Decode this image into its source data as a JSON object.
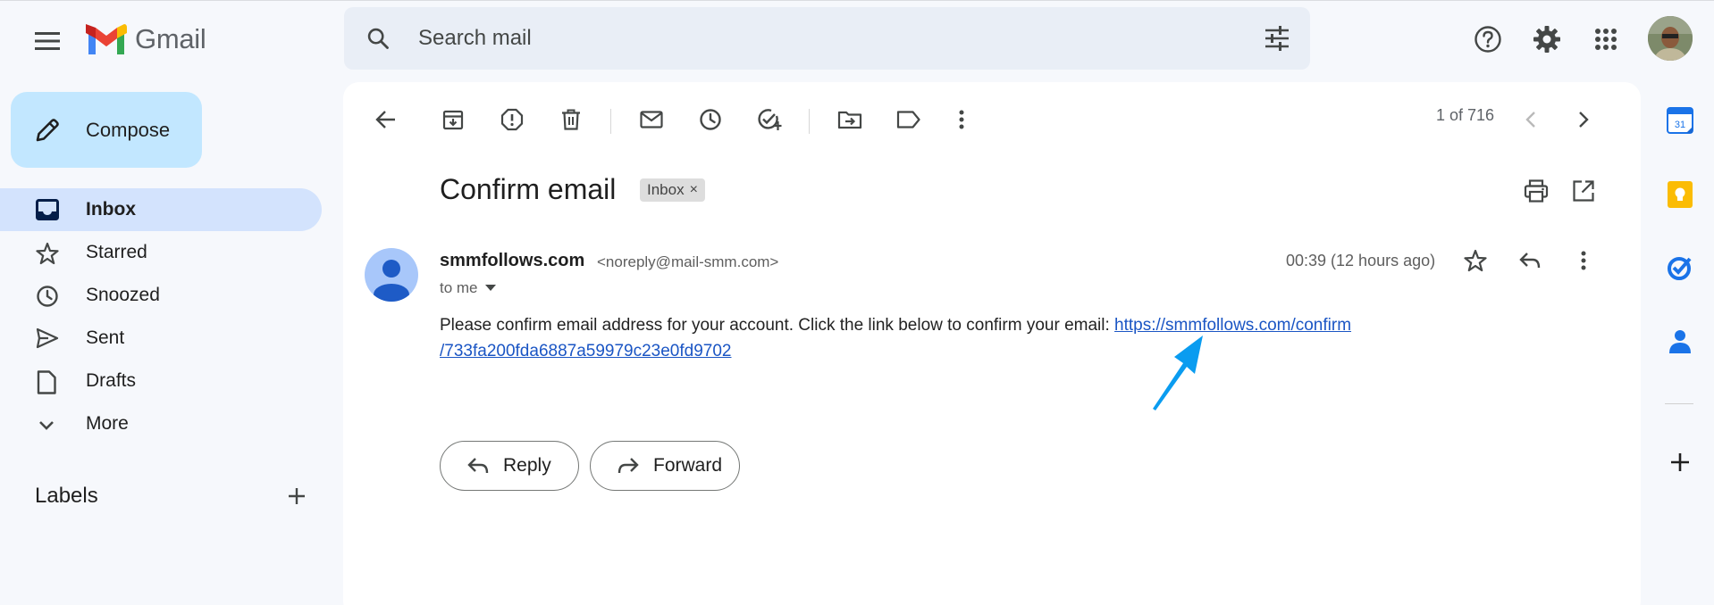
{
  "app": {
    "name": "Gmail"
  },
  "header": {
    "search_placeholder": "Search mail",
    "icons": [
      "menu-icon",
      "search-icon",
      "tune-icon",
      "help-icon",
      "settings-icon",
      "apps-icon",
      "account-avatar"
    ]
  },
  "sidebar": {
    "compose_label": "Compose",
    "items": [
      {
        "label": "Inbox",
        "icon": "inbox-icon",
        "active": true
      },
      {
        "label": "Starred",
        "icon": "star-icon"
      },
      {
        "label": "Snoozed",
        "icon": "clock-icon"
      },
      {
        "label": "Sent",
        "icon": "send-icon"
      },
      {
        "label": "Drafts",
        "icon": "draft-icon"
      },
      {
        "label": "More",
        "icon": "chevron-down-icon"
      }
    ],
    "labels_title": "Labels"
  },
  "toolbar": {
    "pager": "1 of 716",
    "icons": [
      "back-arrow-icon",
      "archive-icon",
      "report-spam-icon",
      "delete-icon",
      "mark-unread-icon",
      "snooze-icon",
      "add-task-icon",
      "move-to-icon",
      "label-icon",
      "more-vert-icon",
      "newer-icon",
      "older-icon"
    ]
  },
  "email": {
    "subject": "Confirm email",
    "label_chip": "Inbox",
    "chip_close": "×",
    "sender_name": "smmfollows.com",
    "sender_email": "<noreply@mail-smm.com>",
    "recipient": "to me",
    "time": "00:39 (12 hours ago)",
    "body_text": "Please confirm email address for your account. Click the link below to confirm your email: ",
    "link_line1": "https://smmfollows.com/confirm",
    "link_line2": "/733fa200fda6887a59979c23e0fd9702"
  },
  "actions": {
    "reply_label": "Reply",
    "forward_label": "Forward"
  },
  "side_panel": {
    "calendar_day": "31",
    "icons": [
      "calendar-icon",
      "keep-icon",
      "tasks-icon",
      "contacts-icon",
      "add-addon-icon"
    ]
  },
  "colors": {
    "background": "#f6f8fc",
    "compose": "#c2e7ff",
    "nav_active": "#d3e3fd",
    "search": "#e9eef6",
    "link": "#1a55c4",
    "pointer": "#0a9cf0"
  }
}
